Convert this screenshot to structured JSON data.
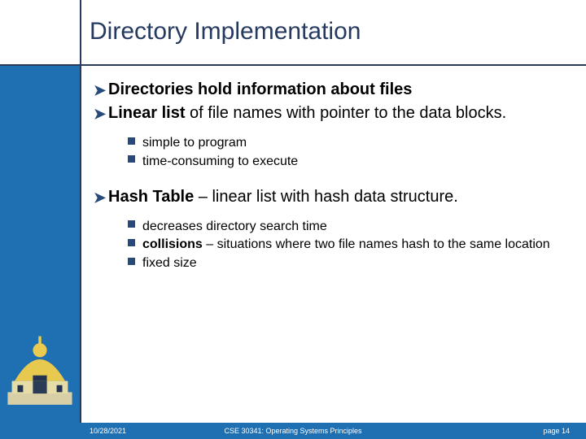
{
  "title": "Directory Implementation",
  "bullets": {
    "b1a": "Directories hold information about files",
    "b1b_strong": "Linear list",
    "b1b_rest": " of file names with pointer to the data blocks.",
    "b1b_s1": "simple to program",
    "b1b_s2": "time-consuming to execute",
    "b1c_strong": "Hash Table",
    "b1c_rest": " – linear list with hash data structure.",
    "b1c_s1": "decreases directory search time",
    "b1c_s2_strong": "collisions",
    "b1c_s2_rest": " – situations where two file names hash to the same location",
    "b1c_s3": "fixed size"
  },
  "footer": {
    "date": "10/28/2021",
    "course": "CSE 30341: Operating Systems Principles",
    "page": "page 14"
  }
}
